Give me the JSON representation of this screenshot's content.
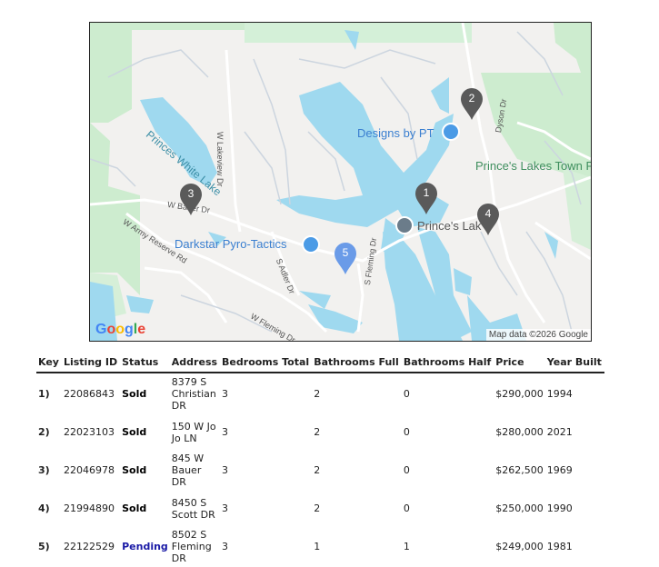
{
  "map": {
    "labels": {
      "princes_white_lake": "Princes White Lake",
      "designs_by_pt": "Designs by PT",
      "princes_lakes_town_park": "Prince's Lakes Town Park",
      "princes_lake": "Prince's Lak",
      "darkstar": "Darkstar Pyro-Tactics",
      "w_lakeview_dr": "W Lakeview Dr",
      "w_bauer_dr": "W Bauer Dr",
      "w_army_reserve_rd": "W Army Reserve Rd",
      "s_adler_dr": "S Adler Dr",
      "s_fleming_dr": "S Fleming Dr",
      "w_fleming_dr": "W Fleming Dr",
      "dyson_dr": "Dyson Dr"
    },
    "markers": [
      {
        "key": "1",
        "color": "#5a5a5a"
      },
      {
        "key": "2",
        "color": "#5a5a5a"
      },
      {
        "key": "3",
        "color": "#5a5a5a"
      },
      {
        "key": "4",
        "color": "#5a5a5a"
      },
      {
        "key": "5",
        "color": "#6a9be8"
      }
    ],
    "google_logo": "Google",
    "attribution": "Map data ©2026 Google"
  },
  "table": {
    "headers": [
      "Key",
      "Listing ID",
      "Status",
      "Address",
      "Bedrooms Total",
      "Bathrooms Full",
      "Bathrooms Half",
      "Price",
      "Year Built"
    ],
    "rows": [
      {
        "key": "1)",
        "listing_id": "22086843",
        "status": "Sold",
        "address": "8379 S Christian DR",
        "bedrooms": "3",
        "baths_full": "2",
        "baths_half": "0",
        "price": "$290,000",
        "year": "1994"
      },
      {
        "key": "2)",
        "listing_id": "22023103",
        "status": "Sold",
        "address": "150 W Jo Jo LN",
        "bedrooms": "3",
        "baths_full": "2",
        "baths_half": "0",
        "price": "$280,000",
        "year": "2021"
      },
      {
        "key": "3)",
        "listing_id": "22046978",
        "status": "Sold",
        "address": "845 W Bauer DR",
        "bedrooms": "3",
        "baths_full": "2",
        "baths_half": "0",
        "price": "$262,500",
        "year": "1969"
      },
      {
        "key": "4)",
        "listing_id": "21994890",
        "status": "Sold",
        "address": "8450 S Scott DR",
        "bedrooms": "3",
        "baths_full": "2",
        "baths_half": "0",
        "price": "$250,000",
        "year": "1990"
      },
      {
        "key": "5)",
        "listing_id": "22122529",
        "status": "Pending",
        "address": "8502 S Fleming DR",
        "bedrooms": "3",
        "baths_full": "1",
        "baths_half": "1",
        "price": "$249,000",
        "year": "1981"
      }
    ]
  }
}
